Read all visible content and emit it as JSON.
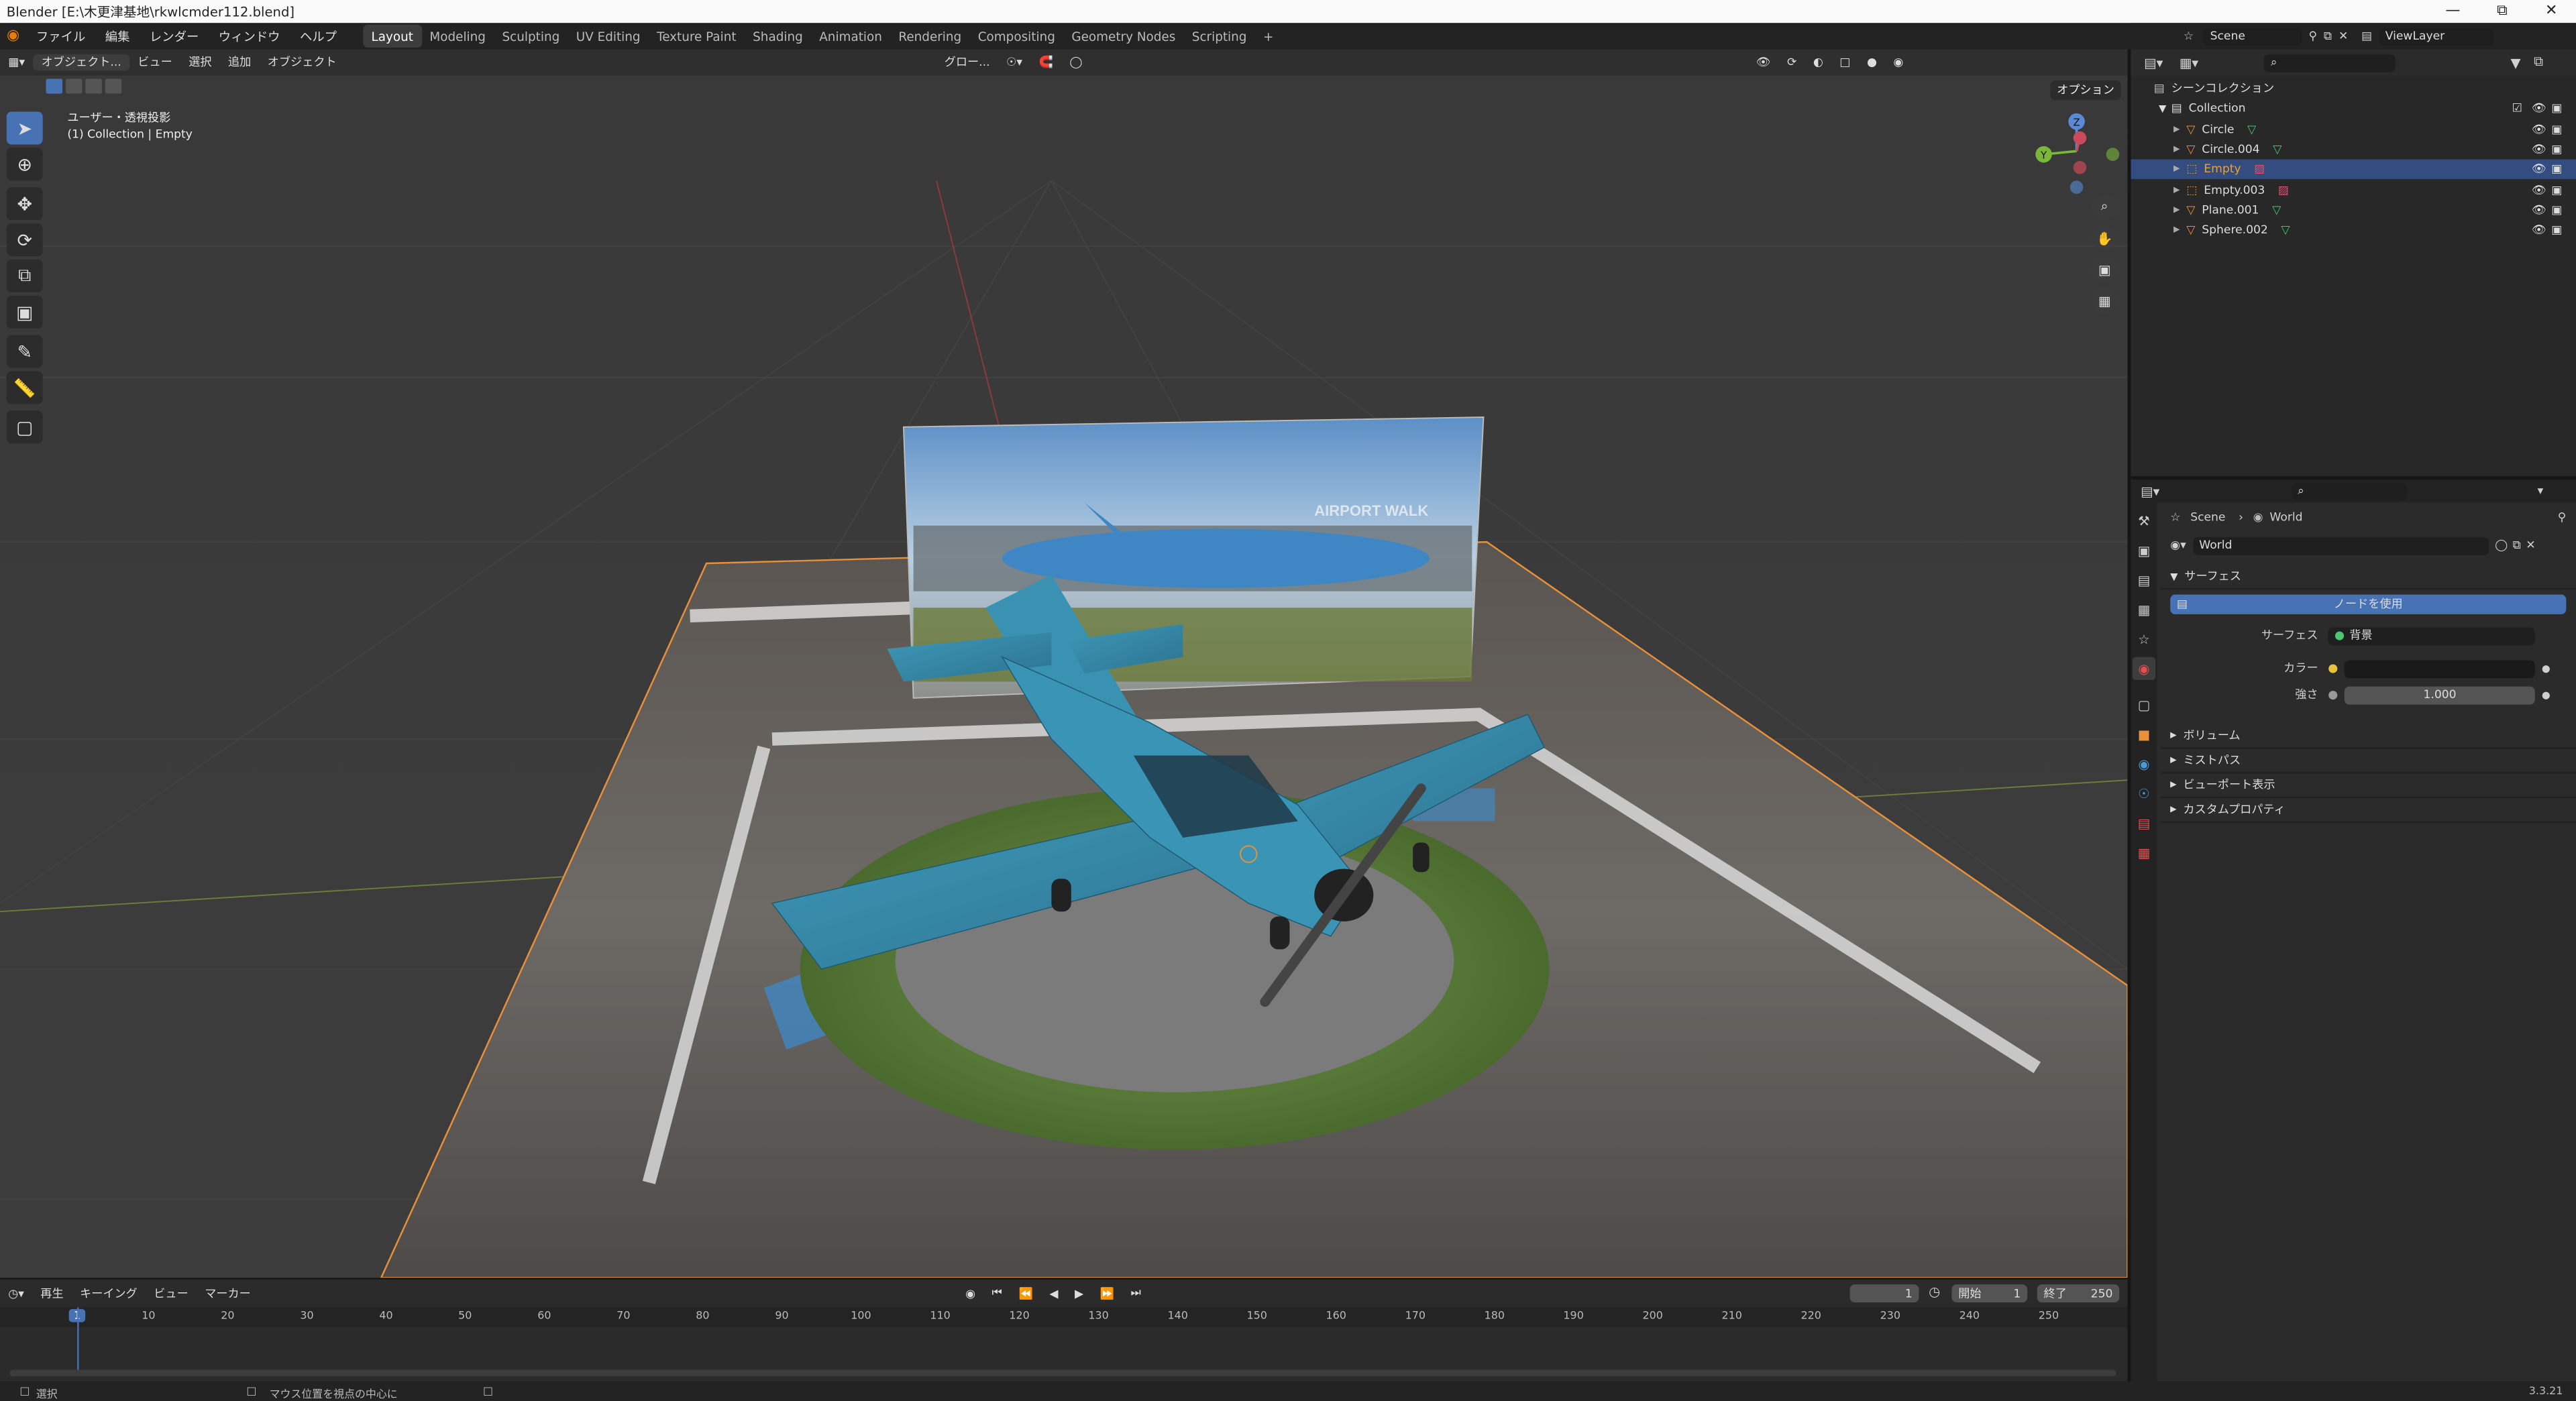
{
  "window": {
    "title": "Blender [E:\\木更津基地\\rkwlcmder112.blend]"
  },
  "menu": {
    "items": [
      "ファイル",
      "編集",
      "レンダー",
      "ウィンドウ",
      "ヘルプ"
    ]
  },
  "workspaces": [
    "Layout",
    "Modeling",
    "Sculpting",
    "UV Editing",
    "Texture Paint",
    "Shading",
    "Animation",
    "Rendering",
    "Compositing",
    "Geometry Nodes",
    "Scripting"
  ],
  "workspace_add": "+",
  "viewport": {
    "mode": "オブジェクト...",
    "menus": [
      "ビュー",
      "選択",
      "追加",
      "オブジェクト"
    ],
    "transform_orientation": "グロー...",
    "options_label": "オプション",
    "overlay_line1": "ユーザー・透視投影",
    "overlay_line2": "(1) Collection | Empty",
    "gizmo_axes": [
      "Z",
      "Y",
      "X"
    ],
    "photo_sign_text": "AIRPORT WALK"
  },
  "timeline": {
    "menus": [
      "再生",
      "キーイング",
      "ビュー",
      "マーカー"
    ],
    "current_frame": "1",
    "start_label": "開始",
    "start": "1",
    "end_label": "終了",
    "end": "250",
    "ruler_ticks": [
      "1",
      "10",
      "20",
      "30",
      "40",
      "50",
      "60",
      "70",
      "80",
      "90",
      "100",
      "110",
      "120",
      "130",
      "140",
      "150",
      "160",
      "170",
      "180",
      "190",
      "200",
      "210",
      "220",
      "230",
      "240",
      "250"
    ]
  },
  "status": {
    "select": "選択",
    "center_view": "マウス位置を視点の中心に",
    "version": "3.3.21"
  },
  "topright": {
    "scene": "Scene",
    "view_layer": "ViewLayer"
  },
  "outliner": {
    "root": "シーンコレクション",
    "collection": "Collection",
    "items": [
      {
        "name": "Circle",
        "type": "mesh",
        "selected": false
      },
      {
        "name": "Circle.004",
        "type": "mesh",
        "selected": false
      },
      {
        "name": "Empty",
        "type": "empty",
        "selected": true
      },
      {
        "name": "Empty.003",
        "type": "empty",
        "selected": false
      },
      {
        "name": "Plane.001",
        "type": "mesh",
        "selected": false
      },
      {
        "name": "Sphere.002",
        "type": "mesh",
        "selected": false
      }
    ]
  },
  "properties": {
    "breadcrumb_scene": "Scene",
    "breadcrumb_world": "World",
    "world_name": "World",
    "surface_panel": "サーフェス",
    "use_nodes_button": "ノードを使用",
    "surface_label": "サーフェス",
    "surface_value": "背景",
    "color_label": "カラー",
    "strength_label": "強さ",
    "strength_value": "1.000",
    "collapsed_panels": [
      "ボリューム",
      "ミストパス",
      "ビューポート表示",
      "カスタムプロパティ"
    ]
  },
  "colors": {
    "accent": "#4772b3",
    "selected_row": "#334d80",
    "plane_body": "#3a8fb0",
    "grass": "#5a7a3a",
    "tarmac": "#808080"
  }
}
